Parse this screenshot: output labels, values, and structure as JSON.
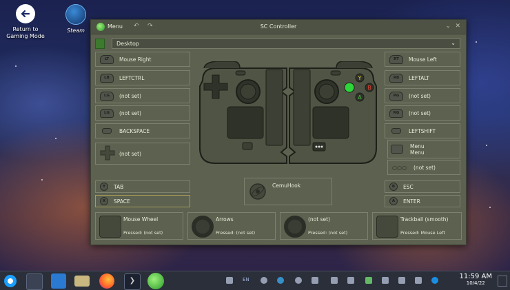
{
  "desktop": {
    "icons": [
      {
        "label_line1": "Return to",
        "label_line2": "Gaming Mode",
        "icon": "return-arrow-icon"
      },
      {
        "label_line1": "Steam",
        "label_line2": "",
        "icon": "steam-icon"
      }
    ]
  },
  "window": {
    "menu_label": "Menu",
    "title": "SC Controller",
    "titlebar_icons": [
      "undo-icon",
      "redo-icon",
      "chevron-down-icon",
      "close-icon"
    ],
    "profile": "Desktop"
  },
  "left_buttons": [
    {
      "icon_text": "LT",
      "label": "Mouse Right"
    },
    {
      "icon_text": "LB",
      "label": "LEFTCTRL"
    },
    {
      "icon_text": "LG",
      "label": "(not set)"
    },
    {
      "icon_text": "LG",
      "label": "(not set)"
    },
    {
      "icon_text": "",
      "label": "BACKSPACE"
    },
    {
      "icon_text": "",
      "label": "(not set)"
    }
  ],
  "right_buttons": [
    {
      "icon_text": "RT",
      "label": "Mouse Left"
    },
    {
      "icon_text": "RB",
      "label": "LEFTALT"
    },
    {
      "icon_text": "RG",
      "label": "(not set)"
    },
    {
      "icon_text": "RG",
      "label": "(not set)"
    },
    {
      "icon_text": "",
      "label": "LEFTSHIFT"
    },
    {
      "icon_text": "",
      "label_line1": "Menu",
      "label_line2": "Menu"
    },
    {
      "icon_text": "",
      "label": "(not set)"
    }
  ],
  "face_buttons": {
    "y": {
      "icon_text": "Y",
      "label": "TAB"
    },
    "x": {
      "icon_text": "X",
      "label": "SPACE"
    },
    "b": {
      "icon_text": "B",
      "label": "ESC"
    },
    "a": {
      "icon_text": "A",
      "label": "ENTER"
    }
  },
  "gyro": {
    "label": "CemuHook"
  },
  "bottom_boxes": [
    {
      "name": "Mouse Wheel",
      "pressed": "Pressed: (not set)"
    },
    {
      "name": "Arrows",
      "pressed": "Pressed: (not set)"
    },
    {
      "name": "(not set)",
      "pressed": "Pressed: (not set)"
    },
    {
      "name": "Trackball (smooth)",
      "pressed": "Pressed: Mouse Left"
    }
  ],
  "controller_face_letters": {
    "y": "Y",
    "b": "B",
    "a": "A"
  },
  "taskbar": {
    "apps": [
      "steamos-logo-icon",
      "settings-mixer-icon",
      "discover-store-icon",
      "file-manager-icon",
      "firefox-icon",
      "terminal-icon",
      "sc-controller-icon"
    ],
    "tray": [
      "notification-bell-icon",
      "language-indicator-icon",
      "steam-tray-icon",
      "tray-app-icon",
      "system-update-icon",
      "keyboard-icon",
      "clipboard-icon",
      "volume-icon",
      "battery-icon",
      "bluetooth-icon",
      "network-icon",
      "display-icon",
      "steamos-tray-icon"
    ],
    "language": "EN",
    "time": "11:59 AM",
    "date": "10/4/22"
  }
}
